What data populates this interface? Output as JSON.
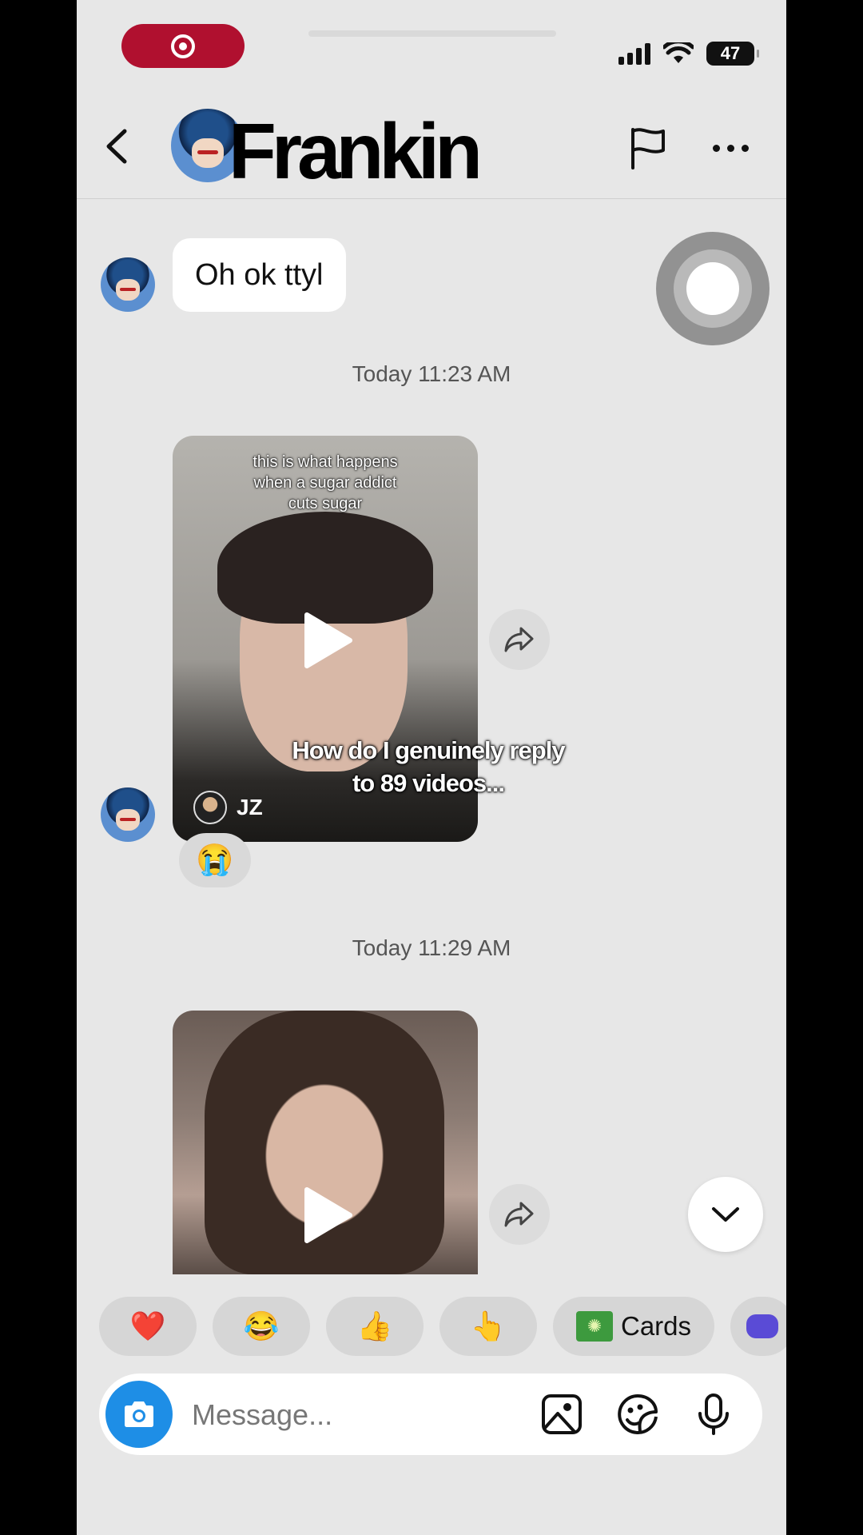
{
  "status_bar": {
    "battery": "47"
  },
  "header": {
    "contact_name": "Frankin"
  },
  "messages": {
    "first_bubble": "Oh ok ttyl",
    "timestamp_1": "Today 11:23 AM",
    "video1": {
      "caption": "this is what happens\nwhen a sugar addict\ncuts sugar",
      "author": "JZ",
      "reaction": "😭"
    },
    "timestamp_2": "Today 11:29 AM"
  },
  "overlay": {
    "text": "How do I genuinely reply\nto 89 videos..."
  },
  "quick_reactions": [
    "❤️",
    "😂",
    "👍",
    "👆"
  ],
  "cards_label": "Cards",
  "composer": {
    "placeholder": "Message..."
  },
  "colors": {
    "record": "#b0102f",
    "camera": "#1e8ee6",
    "bg": "#e7e7e7"
  }
}
